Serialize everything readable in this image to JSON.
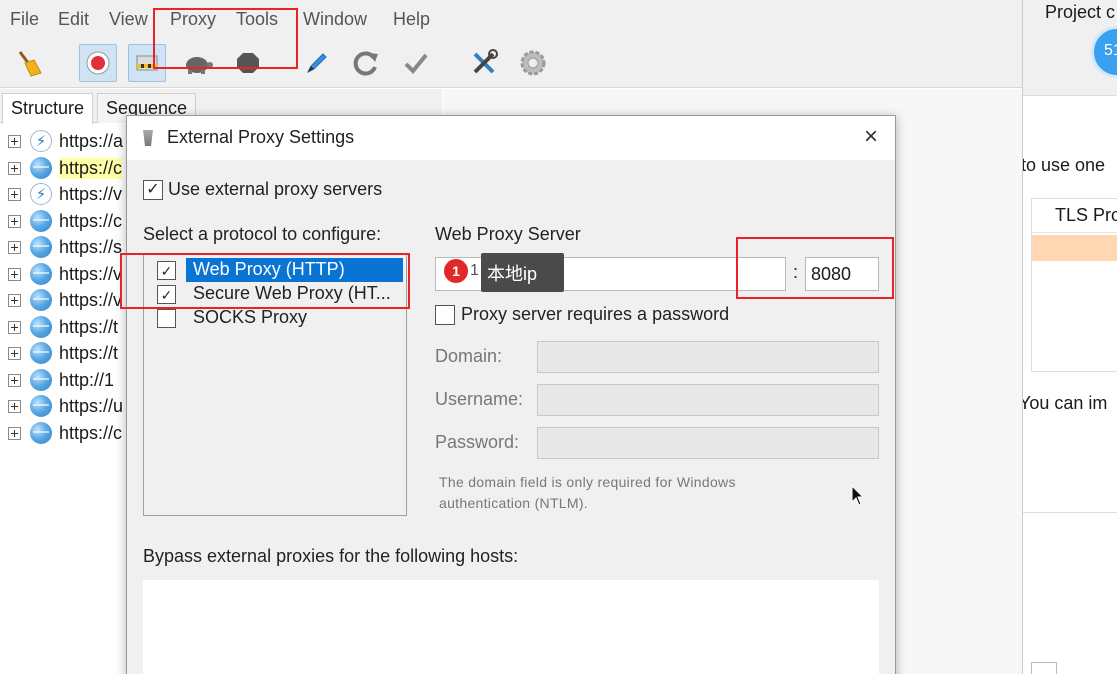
{
  "menubar": {
    "items": [
      "File",
      "Edit",
      "View",
      "Proxy",
      "Tools",
      "Window",
      "Help"
    ]
  },
  "toolbar": {
    "icons": [
      "broom-icon",
      "record-icon",
      "throttle-icon",
      "turtle-icon",
      "stop-icon",
      "pen-icon",
      "refresh-icon",
      "check-icon",
      "tools-icon",
      "settings-icon"
    ]
  },
  "left_panel": {
    "tabs": [
      "Structure",
      "Sequence"
    ],
    "tree": [
      {
        "label": "https://a",
        "icon": "bolt-icon",
        "highlight": false
      },
      {
        "label": "https://c",
        "icon": "globe-icon",
        "highlight": true
      },
      {
        "label": "https://v",
        "icon": "bolt-icon",
        "highlight": false
      },
      {
        "label": "https://c",
        "icon": "globe-icon",
        "highlight": false
      },
      {
        "label": "https://s",
        "icon": "globe-icon",
        "highlight": false
      },
      {
        "label": "https://v",
        "icon": "globe-icon",
        "highlight": false
      },
      {
        "label": "https://v",
        "icon": "globe-icon",
        "highlight": false
      },
      {
        "label": "https://t",
        "icon": "globe-icon",
        "highlight": false
      },
      {
        "label": "https://t",
        "icon": "globe-icon",
        "highlight": false
      },
      {
        "label": "http://1",
        "icon": "globe-icon",
        "highlight": false
      },
      {
        "label": "https://u",
        "icon": "globe-icon",
        "highlight": false
      },
      {
        "label": "https://c",
        "icon": "globe-icon",
        "highlight": false
      }
    ]
  },
  "side_panel": {
    "project_label": "Project c",
    "avatar_text": "51",
    "text_1": "to use one",
    "table_header": "TLS Pro",
    "text_2": "You can im"
  },
  "dialog": {
    "title": "External Proxy Settings",
    "close_glyph": "×",
    "use_external_label": "Use external proxy servers",
    "use_external_checked": true,
    "select_protocol_label": "Select a protocol to configure:",
    "protocols": [
      {
        "label": "Web Proxy (HTTP)",
        "checked": true,
        "selected": true
      },
      {
        "label": "Secure Web Proxy (HT...",
        "checked": true,
        "selected": false
      },
      {
        "label": "SOCKS Proxy",
        "checked": false,
        "selected": false
      }
    ],
    "web_proxy_server_label": "Web Proxy Server",
    "host_value": "1",
    "colon": ":",
    "port_value": "8080",
    "requires_password_label": "Proxy server requires a password",
    "requires_password_checked": false,
    "domain_label": "Domain:",
    "username_label": "Username:",
    "password_label": "Password:",
    "domain_note": "The domain field is only required for Windows authentication (NTLM).",
    "bypass_label": "Bypass external proxies for the following hosts:"
  },
  "annotation": {
    "pin_number": "1",
    "tooltip_text": "本地ip",
    "highlight_color": "#e8232a"
  },
  "colors": {
    "selection": "#0a74d4",
    "menubar_bg": "#f0f0f0"
  }
}
